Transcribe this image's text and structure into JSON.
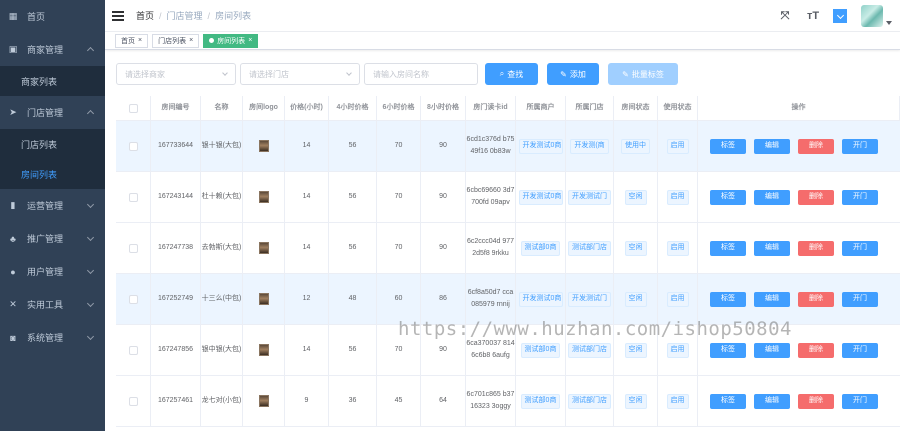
{
  "sidebar": {
    "items": [
      {
        "label": "首页",
        "icon": "dashboard-icon",
        "expanded": null
      },
      {
        "label": "商家管理",
        "icon": "shop-icon",
        "expanded": true,
        "children": [
          {
            "label": "商家列表",
            "active": false
          }
        ]
      },
      {
        "label": "门店管理",
        "icon": "send-icon",
        "expanded": true,
        "children": [
          {
            "label": "门店列表",
            "active": false
          },
          {
            "label": "房间列表",
            "active": true
          }
        ]
      },
      {
        "label": "运营管理",
        "icon": "chart-icon",
        "expanded": false
      },
      {
        "label": "推广管理",
        "icon": "tree-icon",
        "expanded": false
      },
      {
        "label": "用户管理",
        "icon": "user-icon",
        "expanded": false
      },
      {
        "label": "实用工具",
        "icon": "tool-icon",
        "expanded": false
      },
      {
        "label": "系统管理",
        "icon": "system-icon",
        "expanded": false
      }
    ]
  },
  "header": {
    "breadcrumb": [
      "首页",
      "门店管理",
      "房间列表"
    ]
  },
  "tags": [
    {
      "label": "首页",
      "active": false
    },
    {
      "label": "门店列表",
      "active": false
    },
    {
      "label": "房间列表",
      "active": true
    }
  ],
  "filters": {
    "merchant_placeholder": "请选择商家",
    "store_placeholder": "请选择门店",
    "room_placeholder": "请输入房间名称",
    "search_label": "查找",
    "add_label": "添加",
    "batch_label": "批量标签"
  },
  "table": {
    "columns": [
      "房间编号",
      "名称",
      "房间logo",
      "价格(小时)",
      "4小时价格",
      "6小时价格",
      "8小时价格",
      "房门读卡id",
      "所属商户",
      "所属门店",
      "房间状态",
      "使用状态",
      "操作"
    ],
    "rows": [
      {
        "id": "167733644",
        "name": "银十银(大包)",
        "price_h": "14",
        "p4": "56",
        "p6": "70",
        "p8": "90",
        "card": "6cd1c376d b7549f16 0b83w",
        "merchant": "开发测试0商",
        "store": "开发测(商",
        "room_status": "使用中",
        "use_status": "启用",
        "highlight": true
      },
      {
        "id": "167243144",
        "name": "杜十赖(大包)",
        "price_h": "14",
        "p4": "56",
        "p6": "70",
        "p8": "90",
        "card": "6cbc69660 3d7700fd 09apv",
        "merchant": "开发测试0商",
        "store": "开发测试门",
        "room_status": "空闲",
        "use_status": "启用",
        "highlight": false
      },
      {
        "id": "167247738",
        "name": "去勃斯(大包)",
        "price_h": "14",
        "p4": "56",
        "p6": "70",
        "p8": "90",
        "card": "6c2ccc04d 9772d5f8 9rkku",
        "merchant": "测试部0商",
        "store": "测试部门店",
        "room_status": "空闲",
        "use_status": "启用",
        "highlight": false
      },
      {
        "id": "167252749",
        "name": "十三么(中包)",
        "price_h": "12",
        "p4": "48",
        "p6": "60",
        "p8": "86",
        "card": "6cf8a50d7 cca085979 rnnij",
        "merchant": "开发测试0商",
        "store": "开发测试门",
        "room_status": "空闲",
        "use_status": "启用",
        "highlight": true
      },
      {
        "id": "167247856",
        "name": "银中银(大包)",
        "price_h": "14",
        "p4": "56",
        "p6": "70",
        "p8": "90",
        "card": "6ca370037 8146c6b8 6aufg",
        "merchant": "测试部0商",
        "store": "测试部门店",
        "room_status": "空闲",
        "use_status": "启用",
        "highlight": false
      },
      {
        "id": "167257461",
        "name": "龙七对(小包)",
        "price_h": "9",
        "p4": "36",
        "p6": "45",
        "p8": "64",
        "card": "6c701c865 b3716323 3oggy",
        "merchant": "测试部0商",
        "store": "测试部门店",
        "room_status": "空闲",
        "use_status": "启用",
        "highlight": false
      }
    ],
    "actions": {
      "tag": "标签",
      "edit": "编辑",
      "delete": "删除",
      "open": "开门"
    }
  },
  "watermark": "https://www.huzhan.com/ishop50804",
  "colors": {
    "primary": "#409eff",
    "danger": "#f56c6c",
    "sidebar": "#304156",
    "tag_active": "#42b983"
  }
}
